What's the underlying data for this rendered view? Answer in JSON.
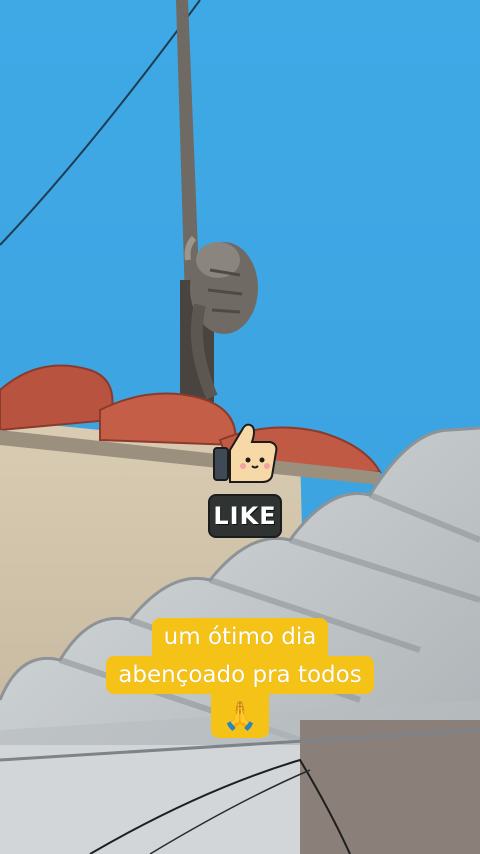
{
  "sticker": {
    "icon": "thumbs-up-icon",
    "label": "LIKE"
  },
  "caption": {
    "line1": "um ótimo dia",
    "line2": "abençoado pra todos",
    "emoji": "🙏"
  },
  "colors": {
    "sky": "#3aa6e3",
    "caption_bg": "#f5c218",
    "badge_bg": "#2f3432"
  }
}
